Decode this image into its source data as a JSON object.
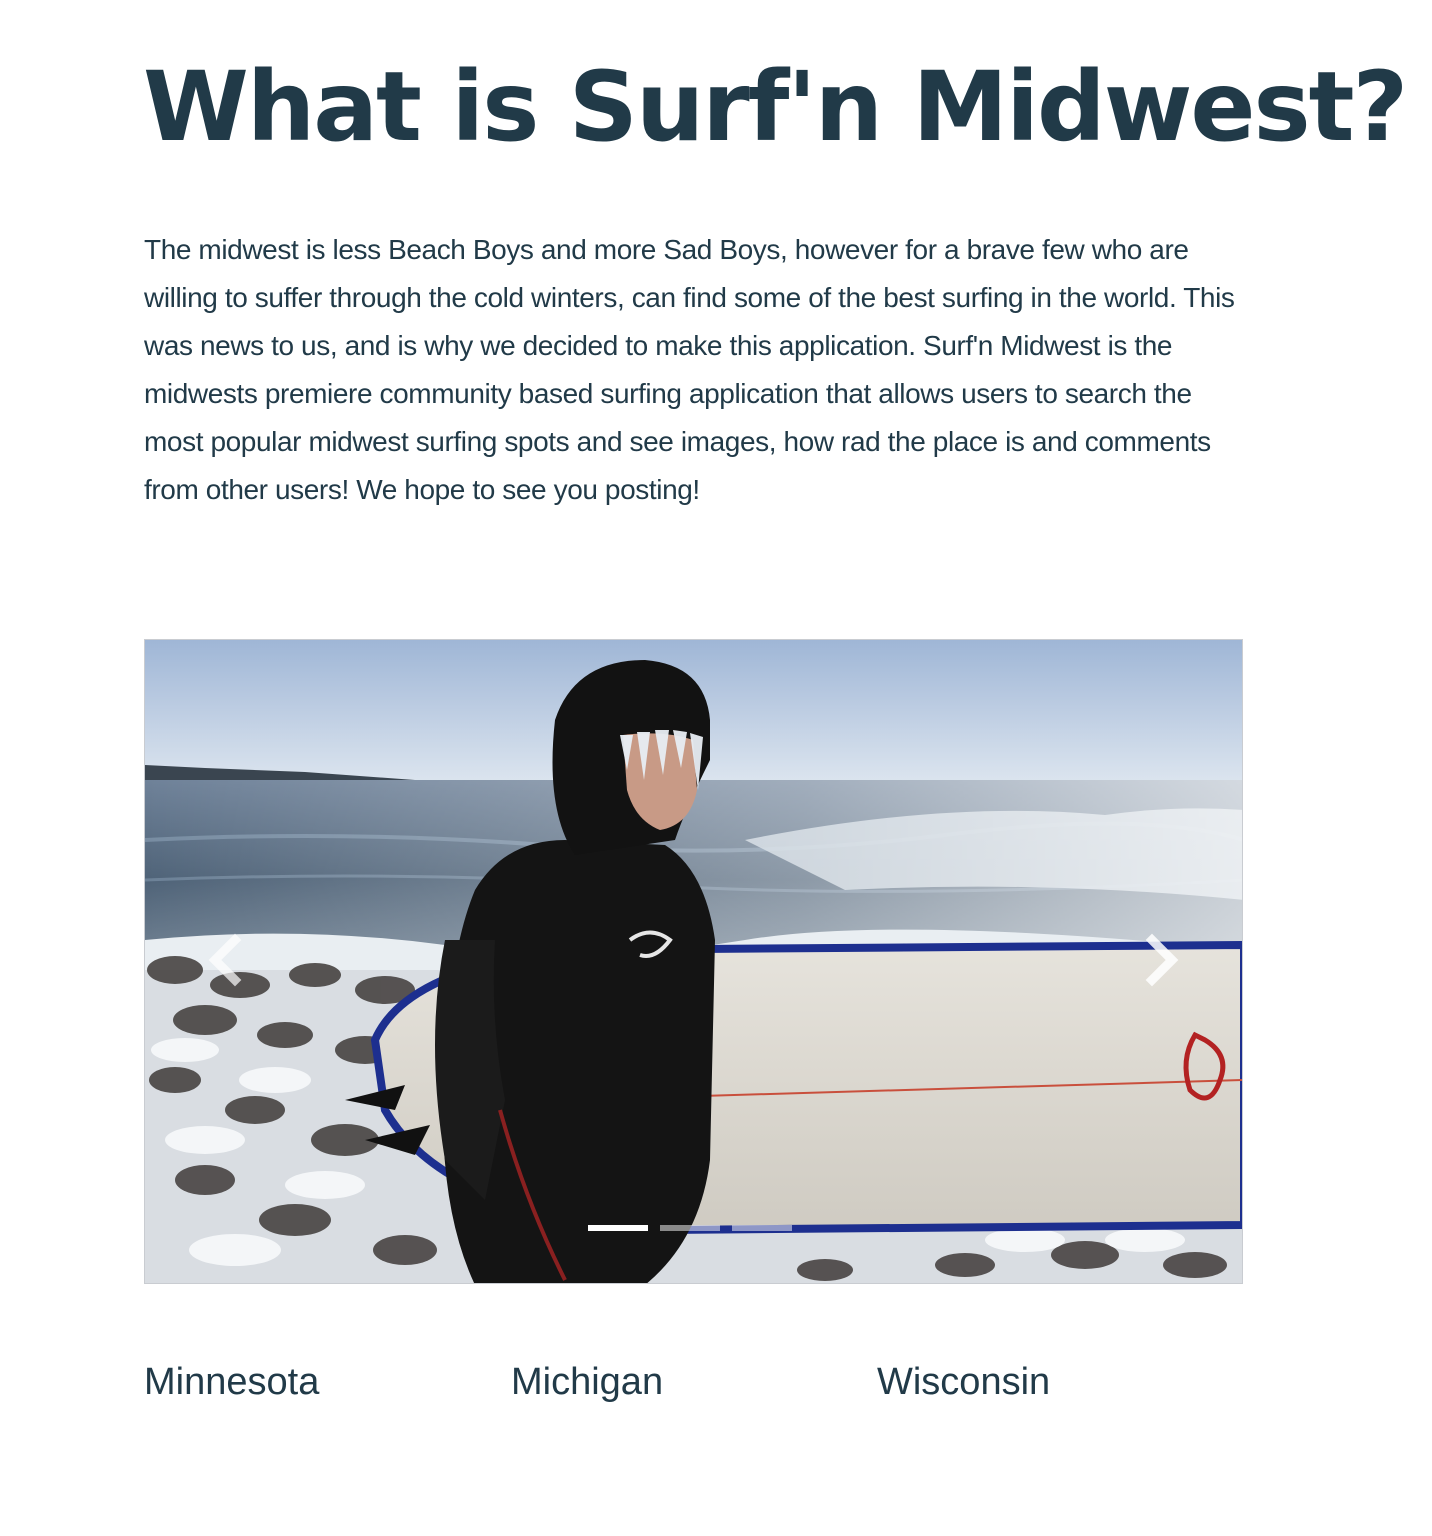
{
  "page": {
    "title": "What is Surf'n Midwest?",
    "intro": "The midwest is less Beach Boys and more Sad Boys, however for a brave few who are willing to suffer through the cold winters, can find some of the best surfing in the world. This was news to us, and is why we decided to make this application. Surf'n Midwest is the midwests premiere community based surfing application that allows users to search the most popular midwest surfing spots and see images, how rad the place is and comments from other users! We hope to see you posting!"
  },
  "carousel": {
    "prev_icon": "chevron-left-icon",
    "next_icon": "chevron-right-icon",
    "slide_count": 3,
    "active_index": 0
  },
  "states": [
    {
      "label": "Minnesota"
    },
    {
      "label": "Michigan"
    },
    {
      "label": "Wisconsin"
    }
  ],
  "colors": {
    "text": "#213a48",
    "background": "#ffffff"
  }
}
